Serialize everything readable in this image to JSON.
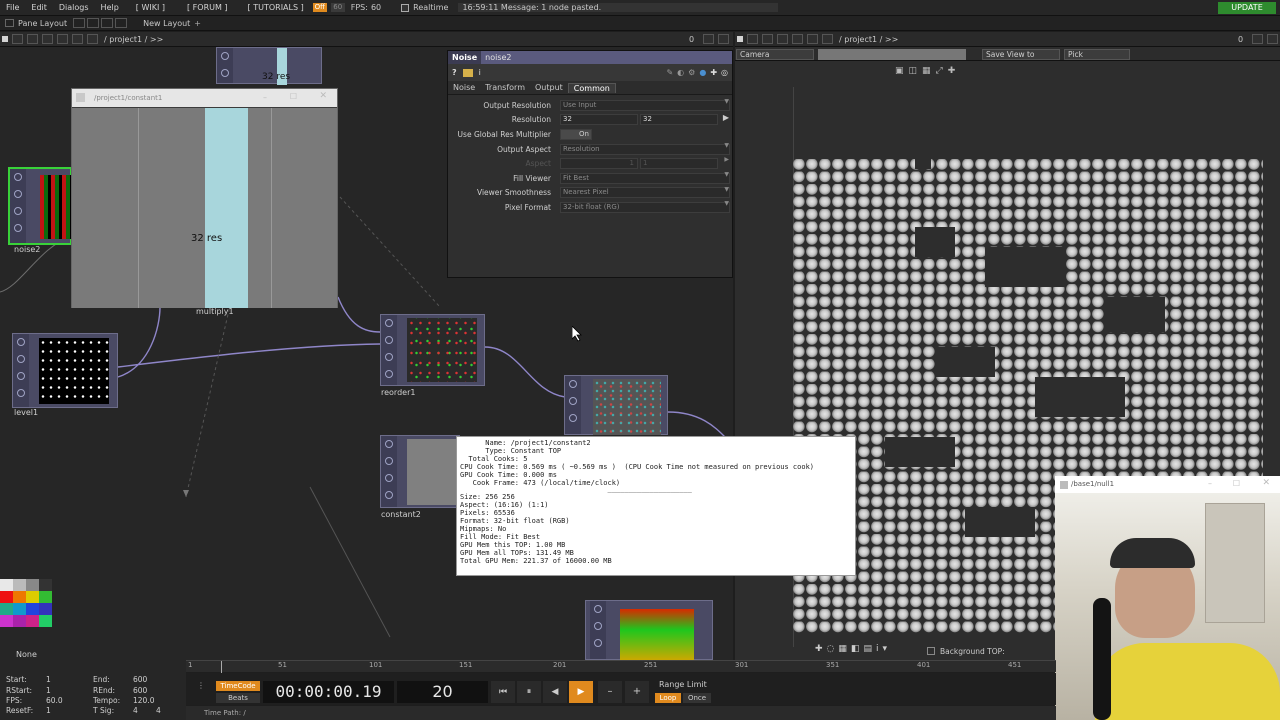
{
  "menu": {
    "items": [
      "File",
      "Edit",
      "Dialogs",
      "Help"
    ],
    "links": [
      "[ WIKI ]",
      "[ FORUM ]",
      "[ TUTORIALS ]"
    ],
    "badge_off": "Off",
    "badge_60": "60",
    "fps_label": "FPS:",
    "fps_value": "60",
    "realtime": "Realtime",
    "message": "16:59:11 Message: 1 node pasted.",
    "update": "UPDATE"
  },
  "layout_bar": {
    "pane_layout": "Pane Layout",
    "new_layout": "New Layout"
  },
  "network_pane": {
    "count": "0",
    "path": "/ project1 / >>"
  },
  "viewer_pane": {
    "count": "0",
    "path": "/ project1 / >>"
  },
  "nodes": {
    "noise2": "noise2",
    "multiply1": "multiply1",
    "level1": "level1",
    "reorder1": "reorder1",
    "constant2": "constant2",
    "top_res": "32 res"
  },
  "viewer_window": {
    "title": "/project1/constant1",
    "text": "32 res"
  },
  "params": {
    "op_type": "Noise",
    "op_name": "noise2",
    "tabs": [
      "Noise",
      "Transform",
      "Output",
      "Common"
    ],
    "rows": [
      {
        "label": "Output Resolution",
        "value": "Use Input"
      },
      {
        "label": "Resolution",
        "value": "32",
        "value2": "32"
      },
      {
        "label": "Use Global Res Multiplier",
        "value": "On"
      },
      {
        "label": "Output Aspect",
        "value": "Resolution"
      },
      {
        "label": "Aspect",
        "value": "1",
        "value2": "1"
      },
      {
        "label": "Fill Viewer",
        "value": "Fit Best"
      },
      {
        "label": "Viewer Smoothness",
        "value": "Nearest Pixel"
      },
      {
        "label": "Pixel Format",
        "value": "32-bit float (RG)"
      }
    ]
  },
  "viewer_controls": {
    "camera": "Camera",
    "save_view": "Save View to",
    "pick": "Pick",
    "background": "Background TOP:"
  },
  "info": {
    "lines": [
      "      Name: /project1/constant2",
      "      Type: Constant TOP",
      "  Total Cooks: 5",
      "CPU Cook Time: 0.569 ms ( ~0.569 ms )  (CPU Cook Time not measured on previous cook)",
      "GPU Cook Time: 0.000 ms",
      "   Cook Frame: 473 (/local/time/clock)",
      "                                   ____________________",
      "Size: 256 256",
      "Aspect: (16:16) (1:1)",
      "Pixels: 65536",
      "Format: 32-bit float (RGB)",
      "Mipmaps: No",
      "Fill Mode: Fit Best",
      "GPU Mem this TOP: 1.00 MB",
      "GPU Mem all TOPs: 131.49 MB",
      "Total GPU Mem: 221.37 of 16000.00 MB"
    ]
  },
  "webcam": {
    "title": "/base1/null1"
  },
  "palette": {
    "none_label": "None"
  },
  "stats": {
    "start_k": "Start:",
    "start_v": "1",
    "rstart_k": "RStart:",
    "rstart_v": "1",
    "fps_k": "FPS:",
    "fps_v": "60.0",
    "resetf_k": "ResetF:",
    "resetf_v": "1",
    "end_k": "End:",
    "end_v": "600",
    "rend_k": "REnd:",
    "rend_v": "600",
    "tempo_k": "Tempo:",
    "tempo_v": "120.0",
    "tsig_k": "T Sig:",
    "tsig_v1": "4",
    "tsig_v2": "4"
  },
  "timeline": {
    "ticks": [
      "1",
      "51",
      "101",
      "151",
      "201",
      "251",
      "301",
      "351",
      "401",
      "451"
    ],
    "timecode_btn": "TimeCode",
    "beats_btn": "Beats",
    "timecode": "00:00:00.19",
    "frame": "20",
    "range_limit": "Range Limit",
    "loop": "Loop",
    "once": "Once",
    "time_path": "Time Path: /"
  },
  "colors": {
    "accent_orange": "#e08a1e",
    "update_green": "#2e8b2e",
    "node_purple": "#4a4a64",
    "selected_green": "#39d239"
  }
}
